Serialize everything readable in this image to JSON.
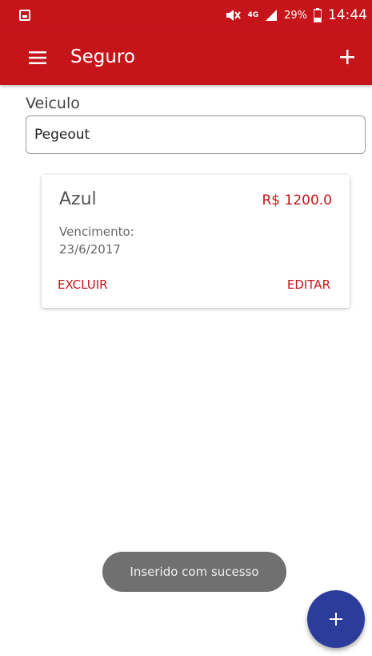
{
  "status_bar": {
    "network_type": "4G",
    "battery_percent": "29%",
    "time": "14:44"
  },
  "app_bar": {
    "title": "Seguro",
    "menu_icon": "menu-icon",
    "add_icon": "plus-icon"
  },
  "form": {
    "vehicle_label": "Veiculo",
    "vehicle_value": "Pegeout"
  },
  "card": {
    "title": "Azul",
    "price": "R$ 1200.0",
    "due_label": "Vencimento:",
    "due_date": "23/6/2017",
    "delete_label": "EXCLUIR",
    "edit_label": "EDITAR"
  },
  "toast": {
    "message": "Inserido com sucesso"
  },
  "fab": {
    "icon": "plus-icon"
  },
  "colors": {
    "primary": "#c5151b",
    "fab": "#2b3c9a",
    "toast": "#707070"
  }
}
